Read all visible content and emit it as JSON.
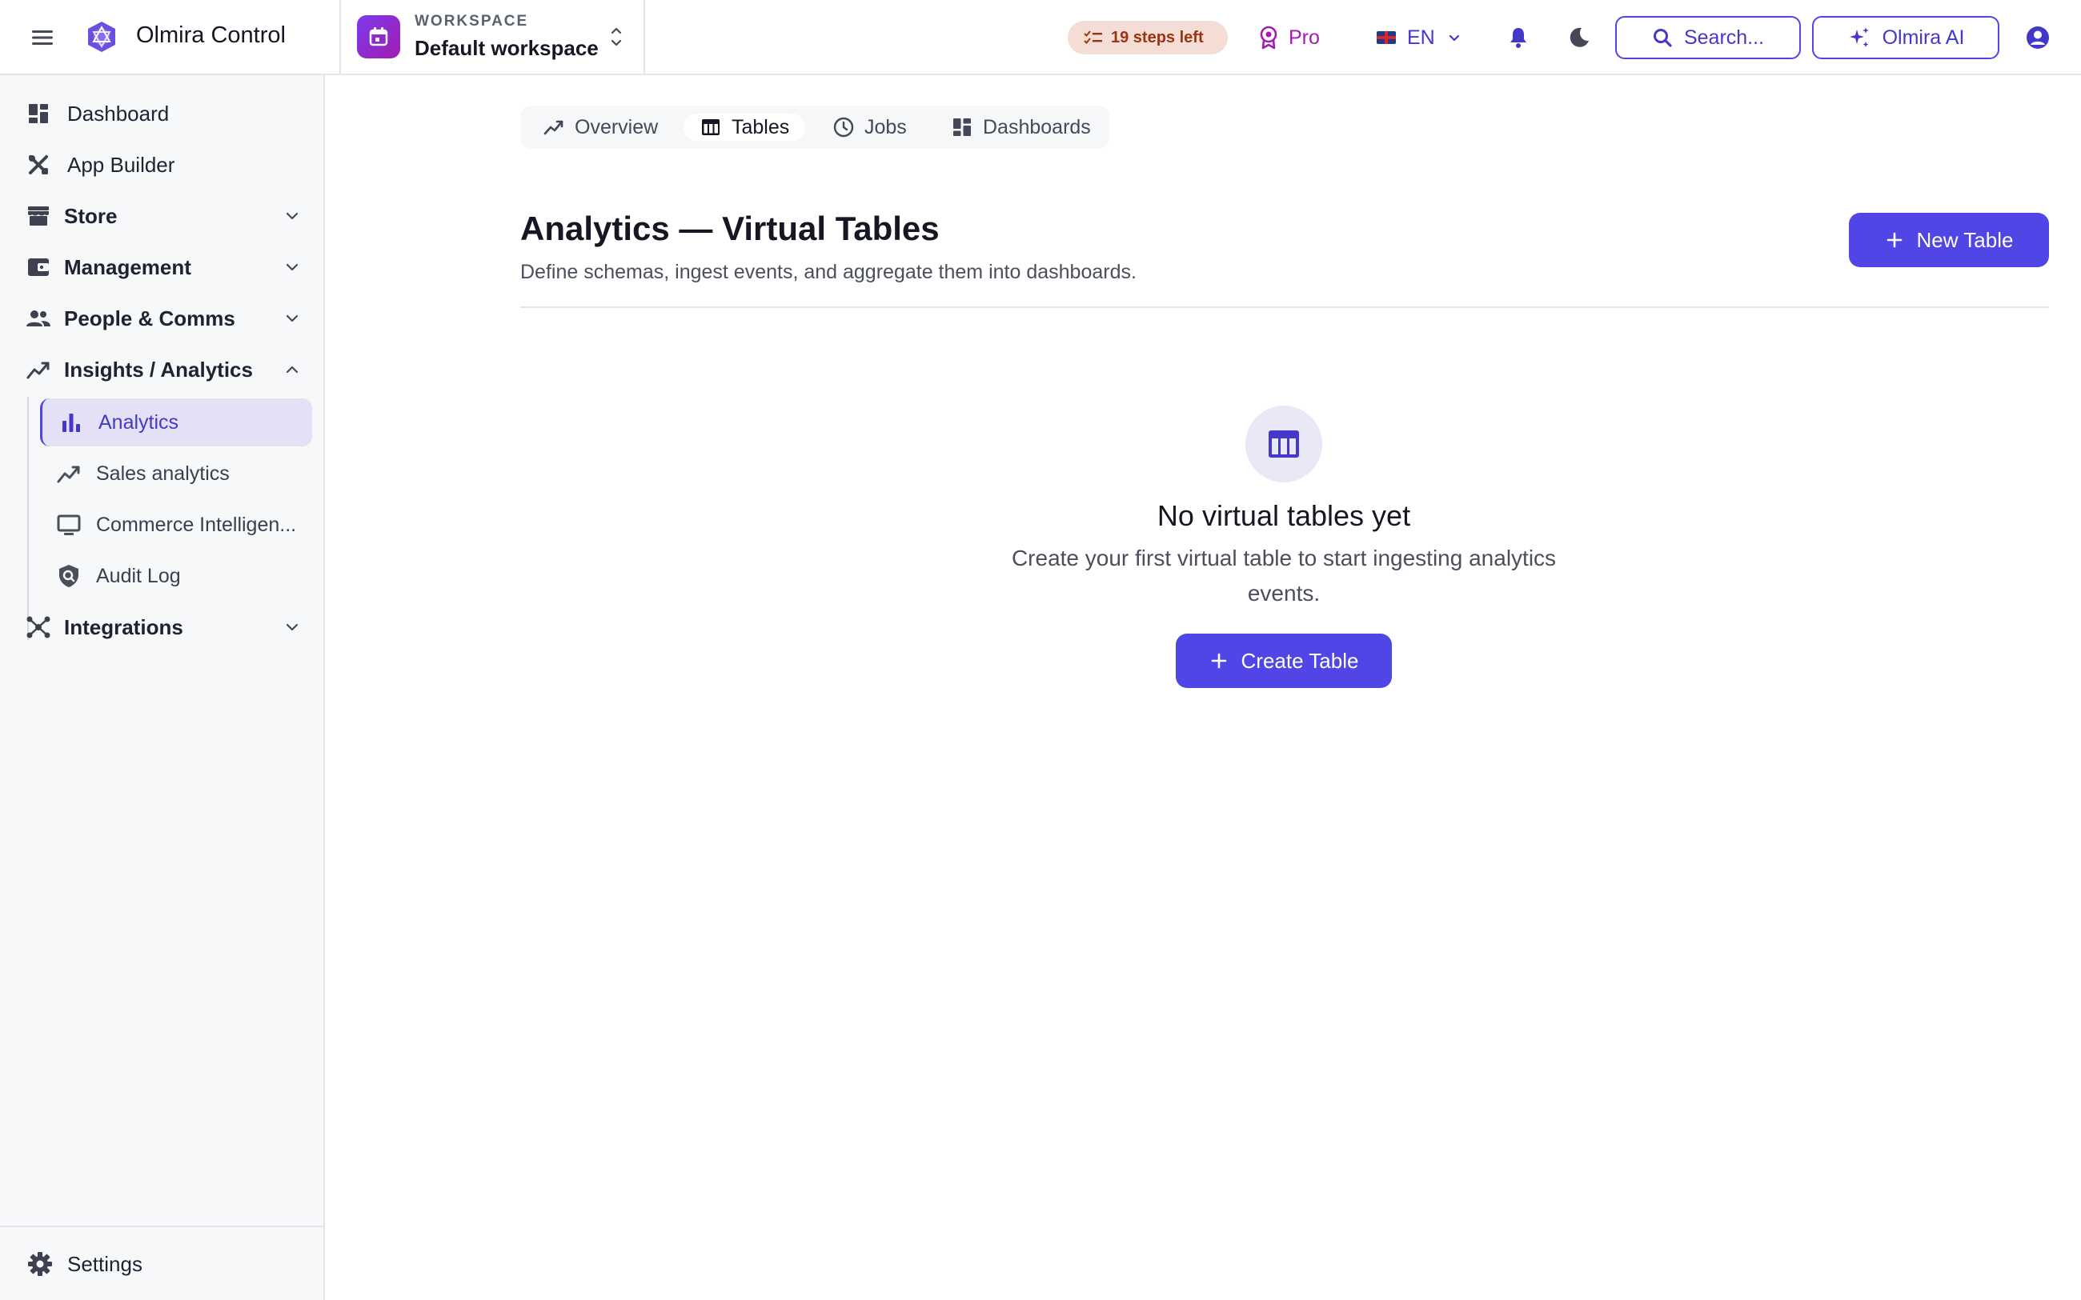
{
  "app": {
    "name": "Olmira Control"
  },
  "workspace": {
    "caption": "WORKSPACE",
    "name": "Default workspace"
  },
  "header": {
    "steps_left": "19 steps left",
    "plan": "Pro",
    "language": "EN",
    "search_label": "Search...",
    "ai_label": "Olmira AI"
  },
  "sidebar": {
    "items": [
      {
        "label": "Dashboard",
        "icon": "dashboard-icon"
      },
      {
        "label": "App Builder",
        "icon": "app-builder-icon"
      },
      {
        "label": "Store",
        "icon": "store-icon"
      },
      {
        "label": "Management",
        "icon": "wallet-icon"
      },
      {
        "label": "People & Comms",
        "icon": "people-icon"
      },
      {
        "label": "Insights / Analytics",
        "icon": "trending-icon"
      },
      {
        "label": "Integrations",
        "icon": "integrations-icon"
      }
    ],
    "sub_items": [
      {
        "label": "Analytics",
        "icon": "bar-chart-icon"
      },
      {
        "label": "Sales analytics",
        "icon": "trending-icon"
      },
      {
        "label": "Commerce Intelligen...",
        "icon": "monitor-icon"
      },
      {
        "label": "Audit Log",
        "icon": "shield-icon"
      }
    ],
    "settings_label": "Settings"
  },
  "tabs": [
    {
      "label": "Overview",
      "icon": "trending-icon"
    },
    {
      "label": "Tables",
      "icon": "table-icon"
    },
    {
      "label": "Jobs",
      "icon": "clock-icon"
    },
    {
      "label": "Dashboards",
      "icon": "dashboard-icon"
    }
  ],
  "page": {
    "title": "Analytics — Virtual Tables",
    "subtitle": "Define schemas, ingest events, and aggregate them into dashboards.",
    "new_table_label": "New Table"
  },
  "empty_state": {
    "title": "No virtual tables yet",
    "description": "Create your first virtual table to start ingesting analytics events.",
    "button_label": "Create Table"
  },
  "colors": {
    "accent": "#4f46e5",
    "accent_text": "#4338ca",
    "active_bg": "#e4e1f7",
    "pill_bg": "#f4ddd4",
    "pill_text": "#9a3412",
    "pro": "#a21caf"
  }
}
